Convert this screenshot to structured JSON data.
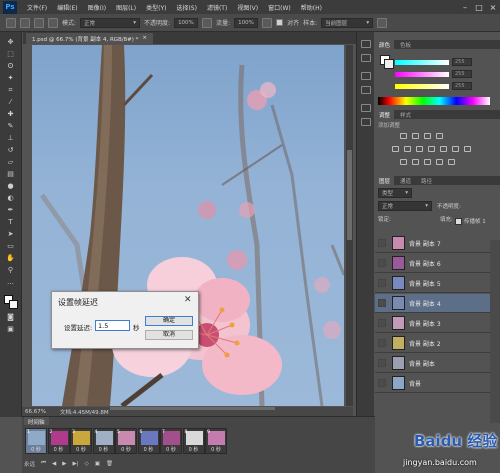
{
  "app": {
    "logo": "Ps",
    "menus": [
      "文件(F)",
      "编辑(E)",
      "图像(I)",
      "图层(L)",
      "类型(Y)",
      "选择(S)",
      "滤镜(T)",
      "视图(V)",
      "窗口(W)",
      "帮助(H)"
    ]
  },
  "options": {
    "mode_label": "模式:",
    "mode_value": "正常",
    "opacity_label": "不透明度:",
    "opacity_value": "100%",
    "flow_label": "流量:",
    "flow_value": "100%",
    "aligned_label": "对齐",
    "sample_label": "样本:",
    "sample_value": "当前图层"
  },
  "document": {
    "tab_title": "1.psd @ 66.7% (背景 副本 4, RGB/8#) *",
    "close": "×"
  },
  "status": {
    "zoom": "66.67%",
    "doc_info": "文档:4.45M/49.8M"
  },
  "timeline": {
    "tab": "时间轴",
    "frames": [
      {
        "index": "1",
        "delay": "0 秒",
        "color": "#8fa9c9"
      },
      {
        "index": "2",
        "delay": "0 秒",
        "color": "#b03a8c"
      },
      {
        "index": "3",
        "delay": "0 秒",
        "color": "#c9a73a"
      },
      {
        "index": "4",
        "delay": "0 秒",
        "color": "#9fb0c4"
      },
      {
        "index": "5",
        "delay": "0 秒",
        "color": "#c98ab0"
      },
      {
        "index": "6",
        "delay": "0 秒",
        "color": "#6a78c0"
      },
      {
        "index": "7",
        "delay": "0 秒",
        "color": "#a24f8c"
      },
      {
        "index": "8",
        "delay": "0 秒",
        "color": "#d9d9d9"
      },
      {
        "index": "9",
        "delay": "0 秒",
        "color": "#c37bb0"
      }
    ],
    "loop": "永远"
  },
  "panels": {
    "color_tabs": [
      "颜色",
      "色板"
    ],
    "color_values": [
      "255",
      "255",
      "255"
    ],
    "adjust_tabs": [
      "调整",
      "样式"
    ],
    "adjust_hint": "添加调整",
    "layer_tabs": [
      "图层",
      "通道",
      "路径"
    ],
    "layer_kind": "类型",
    "blend_mode": "正常",
    "opacity_label": "不透明度:",
    "lock_label": "锁定:",
    "fill_label": "填充:",
    "propagate": "传播帧 1",
    "layers": [
      {
        "name": "背景 副本 7",
        "color": "#c98ab0",
        "selected": false
      },
      {
        "name": "背景 副本 6",
        "color": "#9a5a9a",
        "selected": false
      },
      {
        "name": "背景 副本 5",
        "color": "#7a88c0",
        "selected": false
      },
      {
        "name": "背景 副本 4",
        "color": "#7a8ab0",
        "selected": true
      },
      {
        "name": "背景 副本 3",
        "color": "#c39ab8",
        "selected": false
      },
      {
        "name": "背景 副本 2",
        "color": "#c2b060",
        "selected": false
      },
      {
        "name": "背景 副本",
        "color": "#9aa0b0",
        "selected": false
      },
      {
        "name": "背景",
        "color": "#8aa7c8",
        "selected": false
      }
    ]
  },
  "dialog": {
    "title": "设置帧延迟",
    "close": "✕",
    "label": "设置延迟:",
    "value": "1.5",
    "unit": "秒",
    "ok": "确定",
    "cancel": "取消"
  },
  "watermark": {
    "brand": "Baidu 经验",
    "url": "jingyan.baidu.com"
  }
}
